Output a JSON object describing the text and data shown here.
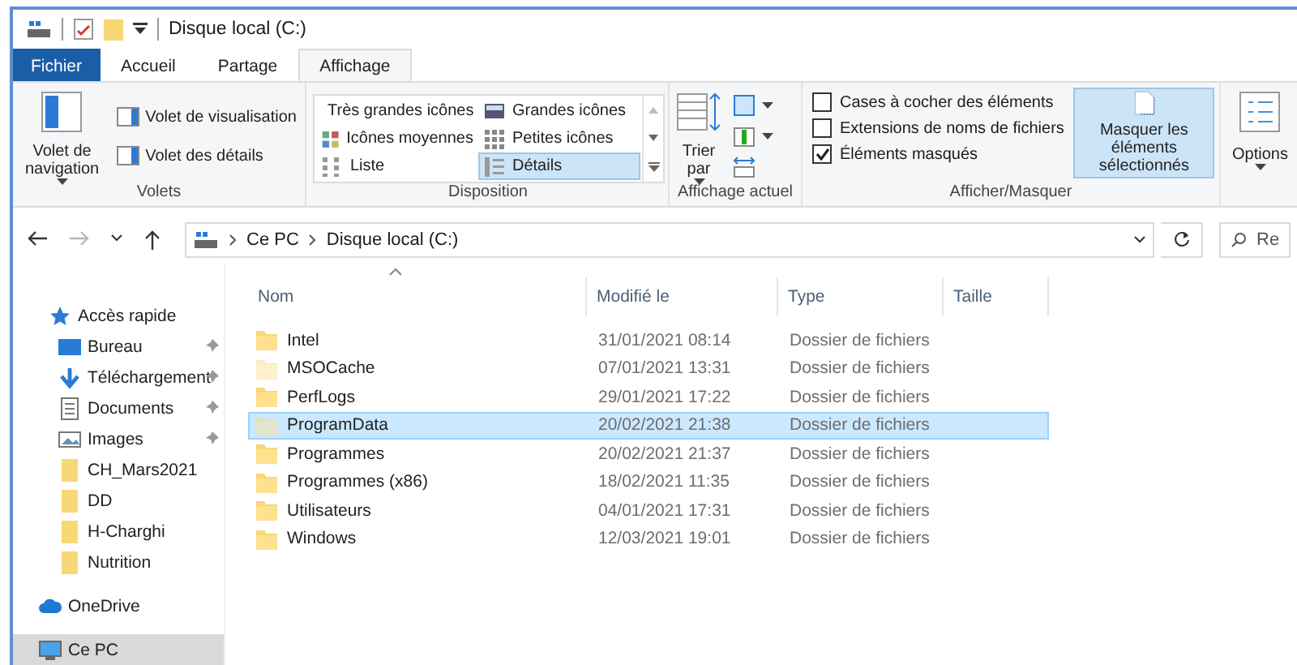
{
  "window": {
    "title": "Disque local (C:)"
  },
  "tabs": [
    {
      "label": "Fichier",
      "kind": "file",
      "selected": false
    },
    {
      "label": "Accueil",
      "kind": "tab",
      "selected": false
    },
    {
      "label": "Partage",
      "kind": "tab",
      "selected": false
    },
    {
      "label": "Affichage",
      "kind": "tab",
      "selected": true
    }
  ],
  "ribbon_groups": [
    {
      "kind": "panes",
      "label": "Volets",
      "big_button": {
        "label": "Volet de navigation"
      },
      "items": [
        {
          "label": "Volet de visualisation"
        },
        {
          "label": "Volet des détails"
        }
      ]
    },
    {
      "kind": "layout",
      "label": "Disposition",
      "items": [
        {
          "label": "Très grandes icônes",
          "selected": false
        },
        {
          "label": "Grandes icônes",
          "selected": false
        },
        {
          "label": "Icônes moyennes",
          "selected": false
        },
        {
          "label": "Petites icônes",
          "selected": false
        },
        {
          "label": "Liste",
          "selected": false
        },
        {
          "label": "Détails",
          "selected": true
        }
      ]
    },
    {
      "kind": "current_view",
      "label": "Affichage actuel",
      "big_button": {
        "label": "Trier par"
      }
    },
    {
      "kind": "show_hide",
      "label": "Afficher/Masquer",
      "checkboxes": [
        {
          "label": "Cases à cocher des éléments",
          "checked": false
        },
        {
          "label": "Extensions de noms de fichiers",
          "checked": false
        },
        {
          "label": "Éléments masqués",
          "checked": true
        }
      ],
      "big_button": {
        "label": "Masquer les éléments sélectionnés",
        "highlighted": true
      }
    },
    {
      "kind": "options",
      "big_button": {
        "label": "Options"
      }
    }
  ],
  "nav_buttons": [
    {
      "kind": "back",
      "disabled": false
    },
    {
      "kind": "forward",
      "disabled": true
    },
    {
      "kind": "recent",
      "disabled": false
    },
    {
      "kind": "up",
      "disabled": false
    }
  ],
  "address": {
    "breadcrumbs": [
      "Ce PC",
      "Disque local (C:)"
    ]
  },
  "search": {
    "placeholder": "Re"
  },
  "sidebar": {
    "items": [
      {
        "label": "Accès rapide",
        "kind": "star",
        "pinned": false,
        "selected": false,
        "group_start": false
      },
      {
        "label": "Bureau",
        "kind": "desktop",
        "pinned": true,
        "selected": false,
        "group_start": false
      },
      {
        "label": "Téléchargement",
        "kind": "download",
        "pinned": true,
        "selected": false,
        "group_start": false
      },
      {
        "label": "Documents",
        "kind": "document",
        "pinned": true,
        "selected": false,
        "group_start": false
      },
      {
        "label": "Images",
        "kind": "pictures",
        "pinned": true,
        "selected": false,
        "group_start": false
      },
      {
        "label": "CH_Mars2021",
        "kind": "folder",
        "pinned": false,
        "selected": false,
        "group_start": false
      },
      {
        "label": "DD",
        "kind": "folder",
        "pinned": false,
        "selected": false,
        "group_start": false
      },
      {
        "label": "H-Charghi",
        "kind": "folder",
        "pinned": false,
        "selected": false,
        "group_start": false
      },
      {
        "label": "Nutrition",
        "kind": "folder",
        "pinned": false,
        "selected": false,
        "group_start": false
      },
      {
        "label": "OneDrive",
        "kind": "cloud",
        "pinned": false,
        "selected": false,
        "group_start": true
      },
      {
        "label": "Ce PC",
        "kind": "pc",
        "pinned": false,
        "selected": true,
        "group_start": true
      }
    ]
  },
  "table": {
    "columns": [
      {
        "label": "Nom",
        "sorted": true
      },
      {
        "label": "Modifié le",
        "sorted": false
      },
      {
        "label": "Type",
        "sorted": false
      },
      {
        "label": "Taille",
        "sorted": false
      }
    ],
    "rows": [
      {
        "name": "Intel",
        "modified": "31/01/2021 08:14",
        "type": "Dossier de fichiers",
        "hidden": false,
        "selected": false
      },
      {
        "name": "MSOCache",
        "modified": "07/01/2021 13:31",
        "type": "Dossier de fichiers",
        "hidden": true,
        "selected": false
      },
      {
        "name": "PerfLogs",
        "modified": "29/01/2021 17:22",
        "type": "Dossier de fichiers",
        "hidden": false,
        "selected": false
      },
      {
        "name": "ProgramData",
        "modified": "20/02/2021 21:38",
        "type": "Dossier de fichiers",
        "hidden": true,
        "selected": true
      },
      {
        "name": "Programmes",
        "modified": "20/02/2021 21:37",
        "type": "Dossier de fichiers",
        "hidden": false,
        "selected": false
      },
      {
        "name": "Programmes (x86)",
        "modified": "18/02/2021 11:35",
        "type": "Dossier de fichiers",
        "hidden": false,
        "selected": false
      },
      {
        "name": "Utilisateurs",
        "modified": "04/01/2021 17:31",
        "type": "Dossier de fichiers",
        "hidden": false,
        "selected": false
      },
      {
        "name": "Windows",
        "modified": "12/03/2021 19:01",
        "type": "Dossier de fichiers",
        "hidden": false,
        "selected": false
      }
    ]
  }
}
